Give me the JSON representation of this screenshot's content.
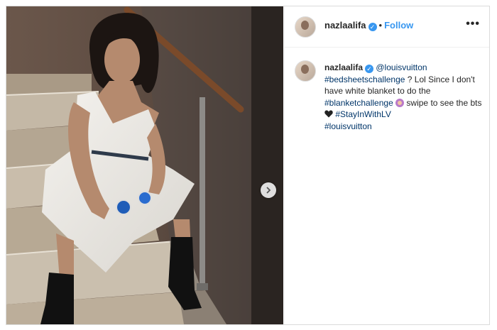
{
  "post": {
    "username": "nazlaalifa",
    "follow_label": "Follow",
    "separator": "•",
    "more_label": "•••"
  },
  "caption": {
    "username": "nazlaalifa",
    "mention": "@louisvuitton",
    "hashtag1": "#bedsheetschallenge",
    "text1": " ? Lol Since I don't have white blanket to do the ",
    "hashtag2": "#blanketchallenge",
    "text2": " swipe to see the bts ",
    "hashtag3": "#StayInWithLV",
    "hashtag4": "#louisvuitton"
  },
  "icons": {
    "verified": "verified-badge-icon",
    "next": "chevron-right-icon",
    "emoji1": "woman-gesturing-emoji",
    "emoji2": "black-heart-emoji"
  },
  "colors": {
    "link": "#003569",
    "follow": "#3897f0",
    "verified": "#3897f0"
  }
}
